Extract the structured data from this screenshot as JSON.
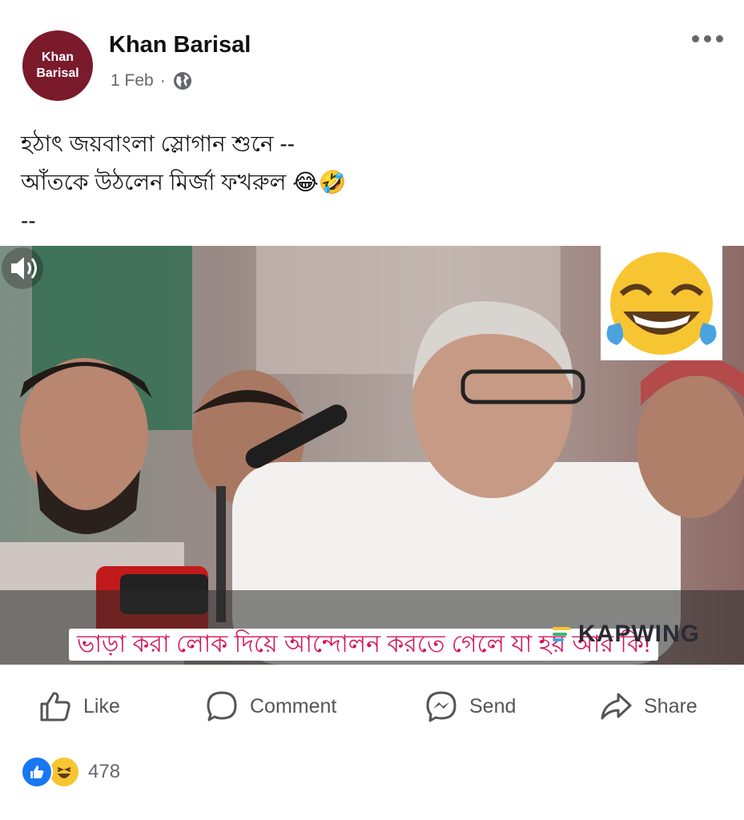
{
  "post": {
    "avatar_line1": "Khan",
    "avatar_line2": "Barisal",
    "author": "Khan Barisal",
    "date": "1 Feb",
    "separator": "·",
    "privacy_icon": "globe-icon",
    "caption": {
      "line1": "হঠাৎ জয়বাংলা স্লোগান শুনে --",
      "line2": "আঁতকে উঠলেন মির্জা ফখরুল 😂🤣",
      "line3": "--"
    }
  },
  "video": {
    "subtitle": "ভাড়া করা লোক দিয়ে আন্দোলন করতে গেলে যা হয় আর কি!",
    "watermark": "KAPWING",
    "overlay_emoji": "😂",
    "volume_icon": "speaker-icon"
  },
  "actions": {
    "like": "Like",
    "comment": "Comment",
    "send": "Send",
    "share": "Share"
  },
  "reactions": {
    "count": "478",
    "types": [
      "like",
      "haha"
    ]
  },
  "colors": {
    "avatar_bg": "#7a1a2a",
    "meta_gray": "#65676b",
    "like_blue": "#1877f2",
    "haha_yellow": "#f7c531",
    "subtitle_red": "#d4145a"
  }
}
